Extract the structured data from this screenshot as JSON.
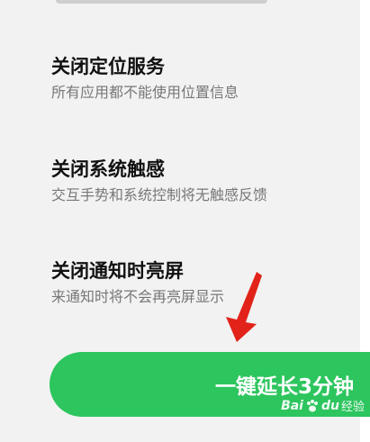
{
  "items": [
    {
      "title": "关闭定位服务",
      "subtitle": "所有应用都不能使用位置信息"
    },
    {
      "title": "关闭系统触感",
      "subtitle": "交互手势和系统控制将无触感反馈"
    },
    {
      "title": "关闭通知时亮屏",
      "subtitle": "来通知时将不会再亮屏显示"
    }
  ],
  "cta": {
    "label": "一键延长3分钟"
  },
  "watermark": {
    "brand_left": "Bai",
    "brand_right": "du",
    "suffix": "经验"
  },
  "colors": {
    "accent": "#2dc55e",
    "arrow": "#e2231a"
  }
}
